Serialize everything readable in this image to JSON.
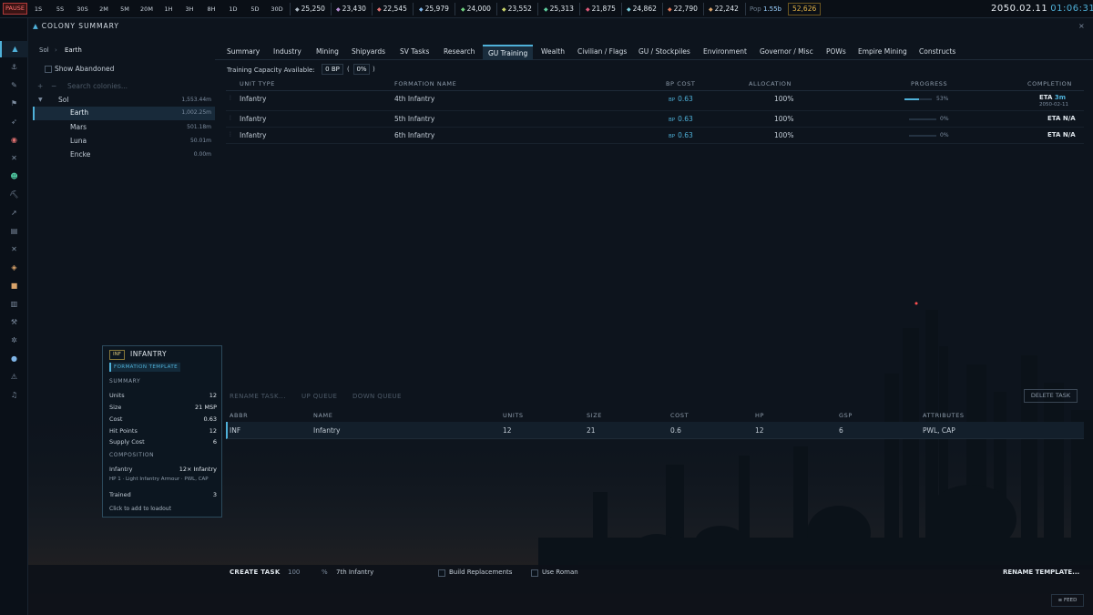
{
  "topbar": {
    "pause": "PAUSE",
    "speeds": [
      "1S",
      "5S",
      "30S",
      "2M",
      "5M",
      "20M",
      "1H",
      "3H",
      "8H",
      "1D",
      "5D",
      "30D"
    ],
    "resources": [
      {
        "icon": "duranium-icon",
        "color": "#aeb9c4",
        "value": "25,250"
      },
      {
        "icon": "neutronium-icon",
        "color": "#b98fd6",
        "value": "23,430"
      },
      {
        "icon": "corbomite-icon",
        "color": "#e07070",
        "value": "22,545"
      },
      {
        "icon": "tritanium-icon",
        "color": "#7fb4e6",
        "value": "25,979"
      },
      {
        "icon": "boronide-icon",
        "color": "#6fcf7f",
        "value": "24,000"
      },
      {
        "icon": "mercassium-icon",
        "color": "#c9d46a",
        "value": "23,552"
      },
      {
        "icon": "vendarite-icon",
        "color": "#5fcf9f",
        "value": "25,313"
      },
      {
        "icon": "sorium-icon",
        "color": "#e05a7a",
        "value": "21,875"
      },
      {
        "icon": "uridium-icon",
        "color": "#7ad0e0",
        "value": "24,862"
      },
      {
        "icon": "corundium-icon",
        "color": "#e07a5a",
        "value": "22,790"
      },
      {
        "icon": "gallicite-icon",
        "color": "#d9a36a",
        "value": "22,242"
      }
    ],
    "pop_label": "Pop",
    "pop_value": "1.55b",
    "wealth": "52,626",
    "date": "2050.02.11",
    "time": "01:06:31"
  },
  "window": {
    "title": "COLONY SUMMARY",
    "close": "×"
  },
  "sidebar": {
    "icons": [
      "colony-icon",
      "anchor-icon",
      "wrench-icon",
      "flag-icon",
      "rocket-icon",
      "target-icon",
      "crossed-swords-icon",
      "person-icon",
      "pickaxe-icon",
      "telescope-icon",
      "clipboard-icon",
      "crossed-icon",
      "tag-icon",
      "box-icon",
      "document-icon",
      "hammer-icon",
      "gear-icon",
      "globe-icon",
      "warning-icon",
      "music-icon"
    ]
  },
  "left": {
    "breadcrumb_root": "Sol",
    "breadcrumb_sep": "›",
    "breadcrumb_current": "Earth",
    "show_abandoned": "Show Abandoned",
    "search_placeholder": "Search colonies...",
    "plus": "+",
    "minus": "−",
    "system": {
      "name": "Sol",
      "value": "1,553.44m"
    },
    "colonies": [
      {
        "name": "Earth",
        "value": "1,002.25m"
      },
      {
        "name": "Mars",
        "value": "501.18m"
      },
      {
        "name": "Luna",
        "value": "50.01m"
      },
      {
        "name": "Encke",
        "value": "0.00m"
      }
    ]
  },
  "tabs": [
    "Summary",
    "Industry",
    "Mining",
    "Shipyards",
    "SV Tasks",
    "Research",
    "GU Training",
    "Wealth",
    "Civilian / Flags",
    "GU / Stockpiles",
    "Environment",
    "Governor / Misc",
    "POWs",
    "Empire Mining",
    "Constructs"
  ],
  "training": {
    "capacity_label": "Training Capacity Available:",
    "capacity_bp": "0 BP",
    "bracket_open": "(",
    "capacity_pct": "0%",
    "bracket_close": ")",
    "headers": [
      "UNIT TYPE",
      "FORMATION NAME",
      "BP COST",
      "ALLOCATION",
      "PROGRESS",
      "COMPLETION"
    ],
    "bp_unit": "BP",
    "rows": [
      {
        "unit": "Infantry",
        "formation": "4th Infantry",
        "bp": "0.63",
        "alloc": "100%",
        "progress": 0.53,
        "progress_label": "53%",
        "eta": "ETA",
        "eta_val": "3m",
        "eta_date": "2050-02-11"
      },
      {
        "unit": "Infantry",
        "formation": "5th Infantry",
        "bp": "0.63",
        "alloc": "100%",
        "progress": 0,
        "progress_label": "0%",
        "eta": "ETA",
        "eta_val": "N/A",
        "eta_date": ""
      },
      {
        "unit": "Infantry",
        "formation": "6th Infantry",
        "bp": "0.63",
        "alloc": "100%",
        "progress": 0,
        "progress_label": "0%",
        "eta": "ETA",
        "eta_val": "N/A",
        "eta_date": ""
      }
    ]
  },
  "tooltip": {
    "abbr": "INF",
    "name": "INFANTRY",
    "tag": "FORMATION TEMPLATE",
    "summary_head": "SUMMARY",
    "summary": [
      {
        "k": "Units",
        "v": "12"
      },
      {
        "k": "Size",
        "v": "21 MSP"
      },
      {
        "k": "Cost",
        "v": "0.63"
      },
      {
        "k": "Hit Points",
        "v": "12"
      },
      {
        "k": "Supply Cost",
        "v": "6"
      }
    ],
    "composition_head": "COMPOSITION",
    "comp_name": "Infantry",
    "comp_count": "12× Infantry",
    "comp_detail": "HP 1 · Light Infantry Armour · PWL, CAP",
    "trained_label": "Trained",
    "trained_value": "3",
    "hint": "Click to add to loadout"
  },
  "templates": {
    "rename_task": "RENAME TASK...",
    "up_queue": "UP QUEUE",
    "down_queue": "DOWN QUEUE",
    "delete_task": "DELETE TASK",
    "headers": [
      "ABBR",
      "NAME",
      "UNITS",
      "SIZE",
      "COST",
      "HP",
      "GSP",
      "ATTRIBUTES"
    ],
    "row": {
      "abbr": "INF",
      "name": "Infantry",
      "units": "12",
      "size": "21",
      "cost": "0.6",
      "hp": "12",
      "gsp": "6",
      "attrs": "PWL, CAP"
    }
  },
  "bottom": {
    "create_task": "CREATE TASK",
    "amount": "100",
    "pct": "%",
    "name": "7th Infantry",
    "build_replacements": "Build Replacements",
    "use_roman": "Use Roman",
    "rename_template": "RENAME TEMPLATE..."
  },
  "feed": "FEED",
  "colors": {
    "accent": "#4fb1d9",
    "wealth": "#e2b347",
    "pause": "#ff7070"
  }
}
